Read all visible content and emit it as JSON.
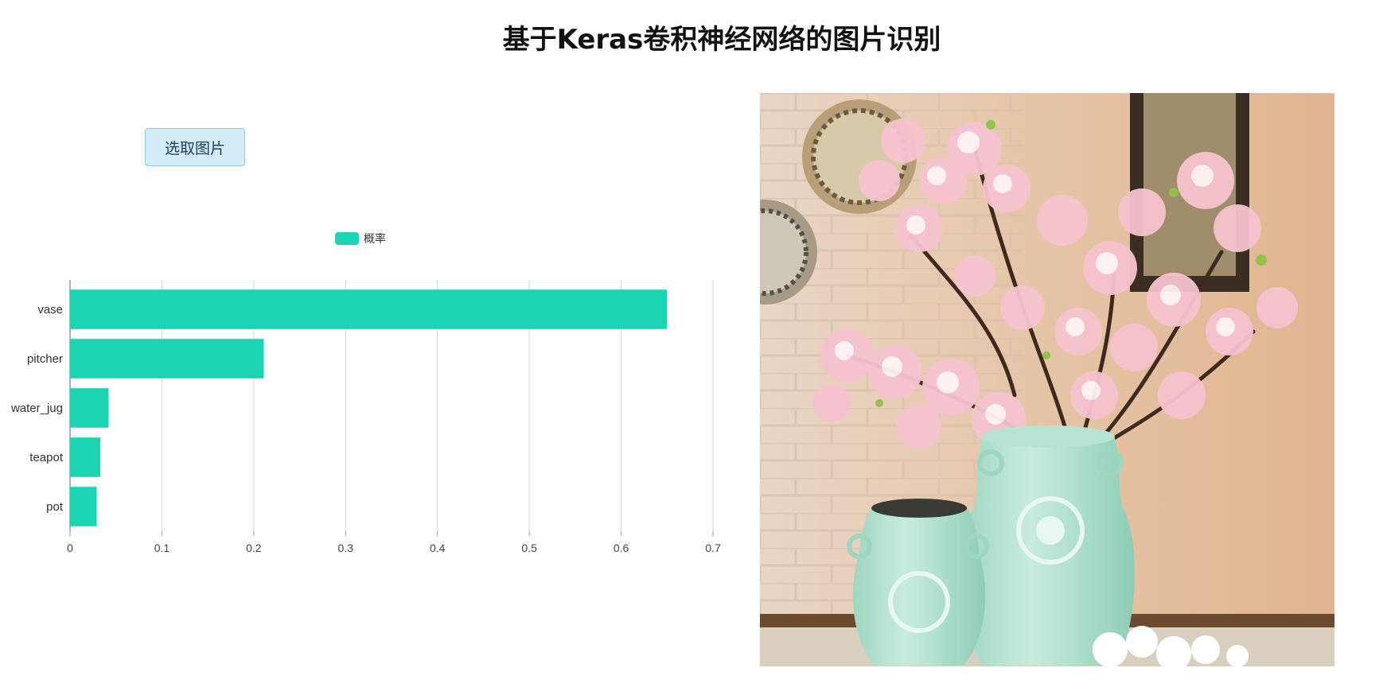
{
  "page": {
    "title": "基于Keras卷积神经网络的图片识别",
    "select_button_label": "选取图片"
  },
  "chart_data": {
    "type": "bar",
    "orientation": "horizontal",
    "categories": [
      "vase",
      "pitcher",
      "water_jug",
      "teapot",
      "pot"
    ],
    "series": [
      {
        "name": "概率",
        "values": [
          0.65,
          0.211,
          0.042,
          0.033,
          0.029
        ],
        "color": "#1cd4b2"
      }
    ],
    "xlim": [
      0,
      0.7
    ],
    "x_ticks": [
      "0",
      "0.1",
      "0.2",
      "0.3",
      "0.4",
      "0.5",
      "0.6",
      "0.7"
    ],
    "grid": "vertical",
    "legend_position": "top-center"
  },
  "image": {
    "subject": "pink cherry blossom branches in a large mint-green vase beside a smaller mint-green jar, against a beige brick wall with decorative plates and a framed picture"
  }
}
